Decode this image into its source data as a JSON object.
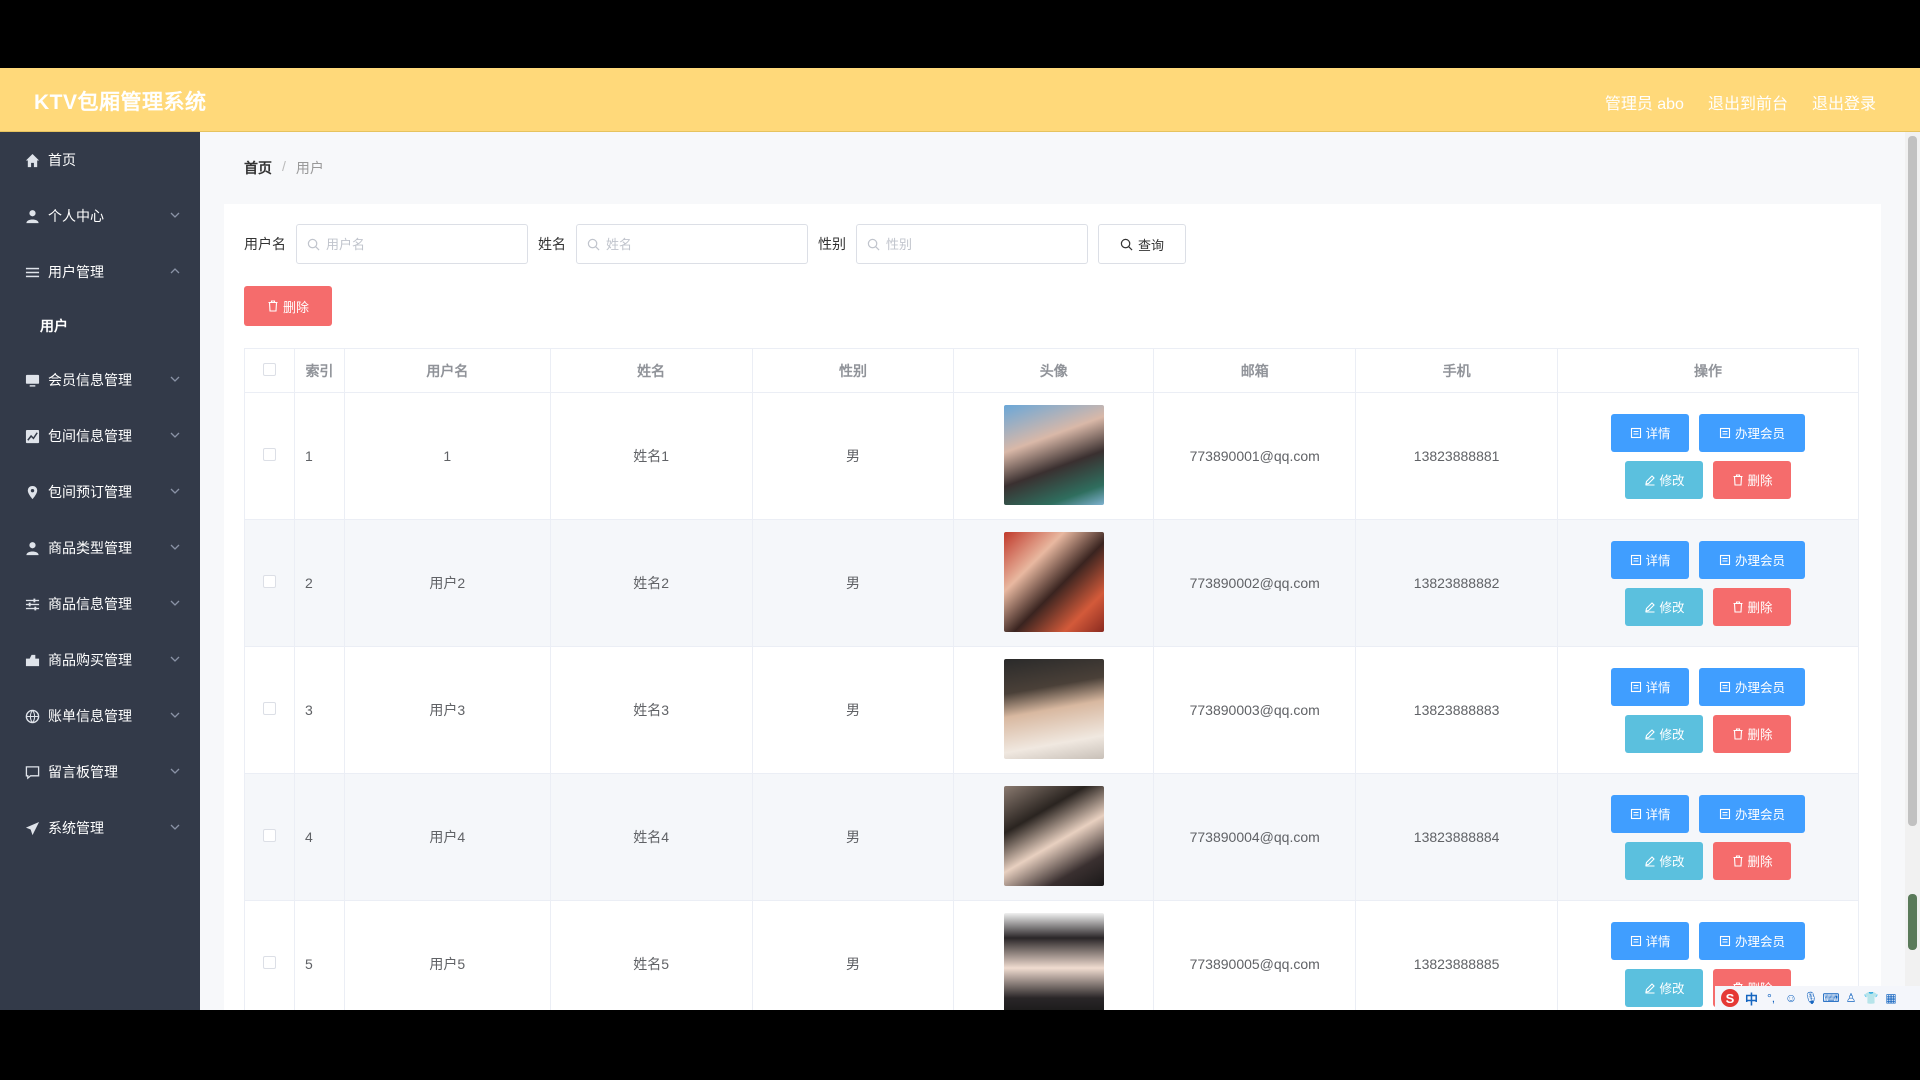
{
  "header": {
    "title": "KTV包厢管理系统",
    "admin": "管理员 abo",
    "to_front": "退出到前台",
    "logout": "退出登录"
  },
  "sidebar": {
    "items": [
      {
        "label": "首页",
        "icon": "home-icon"
      },
      {
        "label": "个人中心",
        "icon": "user-icon"
      },
      {
        "label": "用户管理",
        "icon": "list-icon",
        "expanded": true
      },
      {
        "label": "会员信息管理",
        "icon": "monitor-icon"
      },
      {
        "label": "包间信息管理",
        "icon": "chart-icon"
      },
      {
        "label": "包间预订管理",
        "icon": "location-icon"
      },
      {
        "label": "商品类型管理",
        "icon": "user-icon"
      },
      {
        "label": "商品信息管理",
        "icon": "sliders-icon"
      },
      {
        "label": "商品购买管理",
        "icon": "cart-icon"
      },
      {
        "label": "账单信息管理",
        "icon": "globe-icon"
      },
      {
        "label": "留言板管理",
        "icon": "chat-icon"
      },
      {
        "label": "系统管理",
        "icon": "send-icon"
      }
    ],
    "submenu": [
      "用户"
    ]
  },
  "breadcrumb": {
    "home": "首页",
    "sep": "/",
    "current": "用户"
  },
  "search": {
    "username_label": "用户名",
    "username_placeholder": "用户名",
    "name_label": "姓名",
    "name_placeholder": "姓名",
    "gender_label": "性别",
    "gender_placeholder": "性别",
    "query_label": "查询"
  },
  "toolbar": {
    "delete_label": "删除"
  },
  "table": {
    "headers": [
      "索引",
      "用户名",
      "姓名",
      "性别",
      "头像",
      "邮箱",
      "手机",
      "操作"
    ],
    "rows": [
      {
        "index": "1",
        "username": "1",
        "name": "姓名1",
        "gender": "男",
        "email": "773890001@qq.com",
        "phone": "13823888881"
      },
      {
        "index": "2",
        "username": "用户2",
        "name": "姓名2",
        "gender": "男",
        "email": "773890002@qq.com",
        "phone": "13823888882"
      },
      {
        "index": "3",
        "username": "用户3",
        "name": "姓名3",
        "gender": "男",
        "email": "773890003@qq.com",
        "phone": "13823888883"
      },
      {
        "index": "4",
        "username": "用户4",
        "name": "姓名4",
        "gender": "男",
        "email": "773890004@qq.com",
        "phone": "13823888884"
      },
      {
        "index": "5",
        "username": "用户5",
        "name": "姓名5",
        "gender": "男",
        "email": "773890005@qq.com",
        "phone": "13823888885"
      }
    ],
    "actions": {
      "detail": "详情",
      "member": "办理会员",
      "edit": "修改",
      "delete": "删除"
    }
  },
  "ime": {
    "logo": "S",
    "mode": "中"
  },
  "colors": {
    "header": "#ffd97a",
    "sidebar": "#333a49",
    "primary": "#409eff",
    "danger": "#f56c6c",
    "info": "#5bc0de"
  }
}
